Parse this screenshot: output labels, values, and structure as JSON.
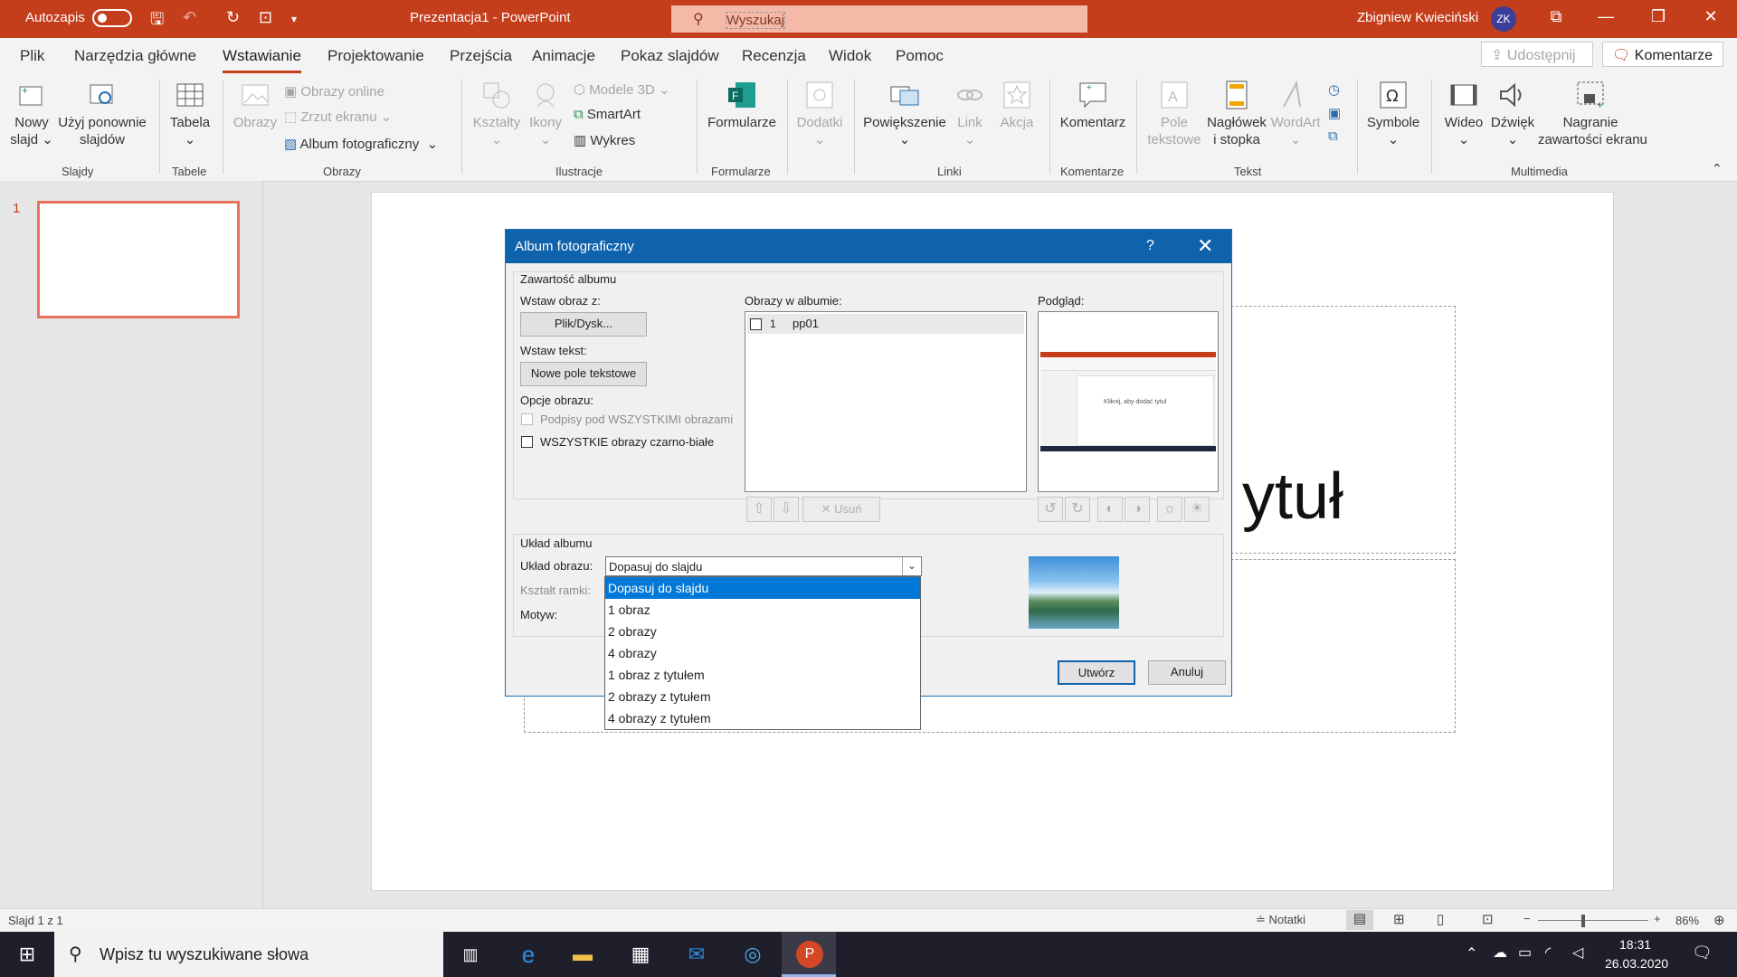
{
  "titlebar": {
    "autosave_label": "Autozapis",
    "doc_title": "Prezentacja1  -  PowerPoint",
    "search_placeholder": "Wyszukaj",
    "user_name": "Zbigniew Kwieciński",
    "user_initials": "ZK",
    "accent_color": "#c43e1c"
  },
  "tabs": [
    "Plik",
    "Narzędzia główne",
    "Wstawianie",
    "Projektowanie",
    "Przejścia",
    "Animacje",
    "Pokaz slajdów",
    "Recenzja",
    "Widok",
    "Pomoc"
  ],
  "active_tab": "Wstawianie",
  "share_label": "Udostępnij",
  "comments_label": "Komentarze",
  "ribbon": {
    "slides": {
      "new_slide_1": "Nowy",
      "new_slide_2": "slajd",
      "reuse_1": "Użyj ponownie",
      "reuse_2": "slajdów",
      "group": "Slajdy"
    },
    "tables": {
      "table": "Tabela",
      "group": "Tabele"
    },
    "images": {
      "pictures": "Obrazy",
      "online": "Obrazy online",
      "screenshot": "Zrzut ekranu",
      "album": "Album fotograficzny",
      "group": "Obrazy"
    },
    "illustrations": {
      "shapes": "Kształty",
      "icons": "Ikony",
      "models3d": "Modele 3D",
      "smartart": "SmartArt",
      "chart": "Wykres",
      "group": "Ilustracje"
    },
    "forms": {
      "forms": "Formularze",
      "group": "Formularze"
    },
    "addins": {
      "addins": "Dodatki"
    },
    "links": {
      "zoom": "Powiększenie",
      "link": "Link",
      "action": "Akcja",
      "group": "Linki"
    },
    "comments": {
      "comment": "Komentarz",
      "group": "Komentarze"
    },
    "text": {
      "textbox_1": "Pole",
      "textbox_2": "tekstowe",
      "header_1": "Nagłówek",
      "header_2": "i stopka",
      "wordart": "WordArt",
      "group": "Tekst"
    },
    "symbols": {
      "symbols": "Symbole"
    },
    "media": {
      "video": "Wideo",
      "audio": "Dźwięk",
      "record_1": "Nagranie",
      "record_2": "zawartości ekranu",
      "group": "Multimedia"
    }
  },
  "thumbnail_number": "1",
  "slide_ghost_text": "ytuł",
  "dialog": {
    "title": "Album fotograficzny",
    "help": "?",
    "content_section": "Zawartość albumu",
    "insert_from": "Wstaw obraz z:",
    "file_button": "Plik/Dysk...",
    "insert_text": "Wstaw tekst:",
    "new_textbox_button": "Nowe pole tekstowe",
    "image_options": "Opcje obrazu:",
    "captions_option": "Podpisy pod WSZYSTKIMI obrazami",
    "bw_option": "WSZYSTKIE obrazy czarno-białe",
    "images_in_album": "Obrazy w albumie:",
    "album_items": [
      {
        "index": "1",
        "name": "pp01"
      }
    ],
    "remove_button": "Usuń",
    "preview_label": "Podgląd:",
    "preview_title_text": "Kliknij, aby dodać tytuł",
    "layout_section": "Układ albumu",
    "picture_layout_label": "Układ obrazu:",
    "picture_layout_value": "Dopasuj do slajdu",
    "frame_shape_label": "Kształt ramki:",
    "theme_label": "Motyw:",
    "layout_options": [
      "Dopasuj do slajdu",
      "1 obraz",
      "2 obrazy",
      "4 obrazy",
      "1 obraz z tytułem",
      "2 obrazy z tytułem",
      "4 obrazy z tytułem"
    ],
    "create_button": "Utwórz",
    "cancel_button": "Anuluj"
  },
  "statusbar": {
    "slide_info": "Slajd 1 z 1",
    "notes": "Notatki",
    "zoom": "86%"
  },
  "taskbar": {
    "search_placeholder": "Wpisz tu wyszukiwane słowa",
    "time": "18:31",
    "date": "26.03.2020"
  }
}
